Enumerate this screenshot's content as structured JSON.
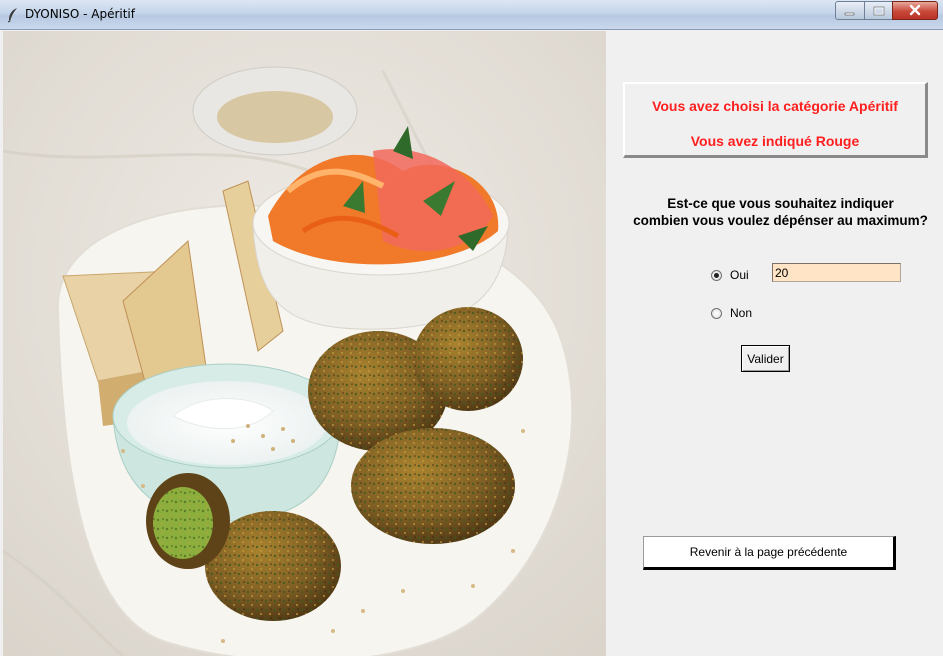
{
  "window": {
    "title": "DYONISO - Apéritif",
    "controls": [
      "minimize-icon",
      "maximize-icon",
      "close-icon"
    ]
  },
  "image": {
    "subject": "food-photo",
    "colors": {
      "tablecloth": "#e9e5df",
      "plate": "#f7f5f0",
      "falafel": "#8a6a2c",
      "salad": "#f0772a",
      "bowl": "#cfe6e0"
    }
  },
  "info_box": {
    "line1": "Vous avez choisi la catégorie Apéritif",
    "line2": "Vous avez indiqué Rouge",
    "text_color": "#ff1f1f"
  },
  "question": {
    "line1": "Est-ce que vous souhaitez indiquer",
    "line2": "combien vous voulez dépénser au maximum?"
  },
  "options": {
    "oui": {
      "label": "Oui",
      "selected": true
    },
    "non": {
      "label": "Non",
      "selected": false
    }
  },
  "amount_input": {
    "value": "20",
    "background": "#ffe4c6"
  },
  "buttons": {
    "validate": "Valider",
    "back": "Revenir à la page précédente"
  }
}
